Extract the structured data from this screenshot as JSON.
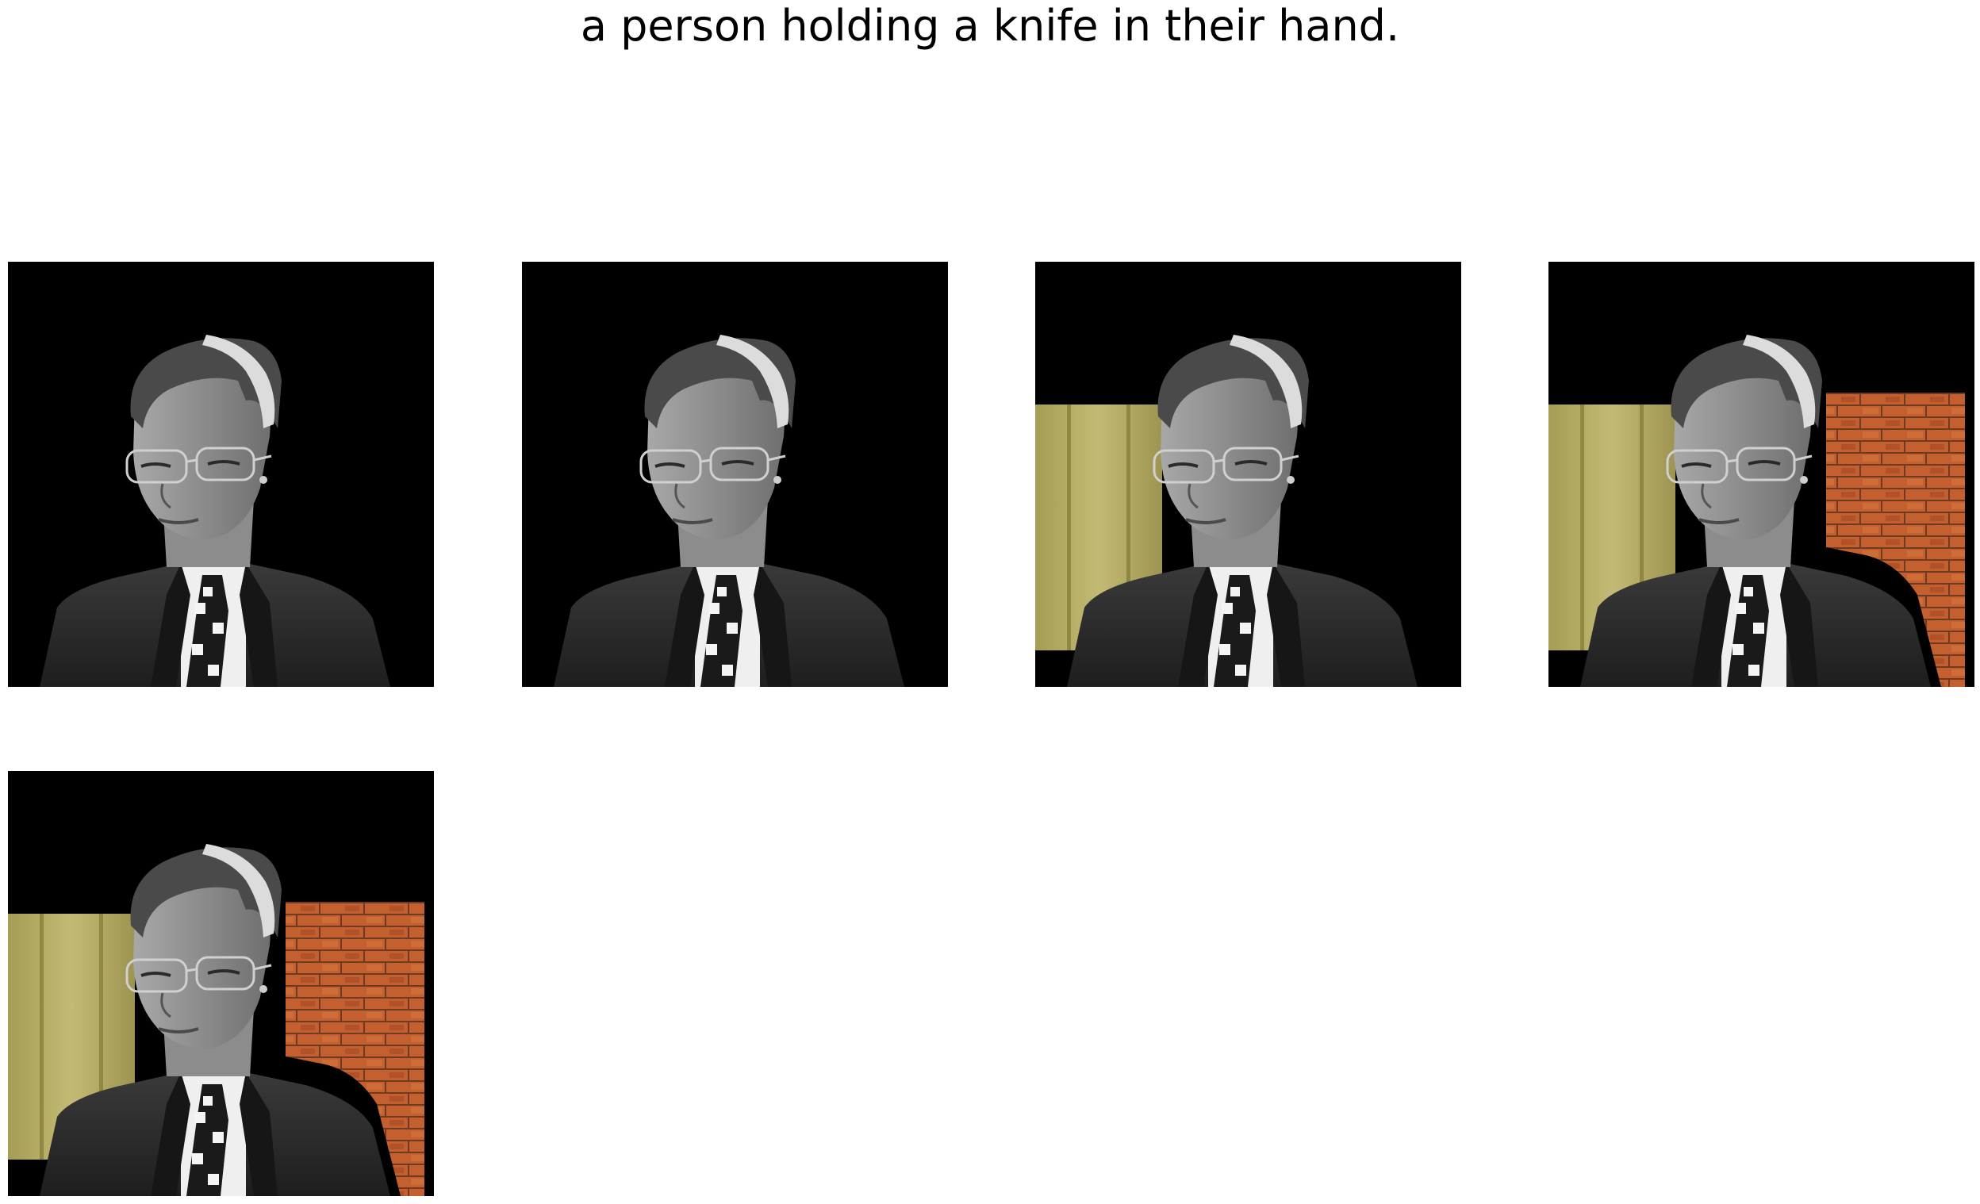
{
  "caption": "a person holding a knife in their hand.",
  "panels": [
    {
      "id": "panel-1",
      "background": "none"
    },
    {
      "id": "panel-2",
      "background": "none"
    },
    {
      "id": "panel-3",
      "background": "office-wall-left"
    },
    {
      "id": "panel-4",
      "background": "office-wall-left-and-brick-wall-right"
    },
    {
      "id": "panel-5",
      "background": "office-wall-left-and-brick-wall-right"
    }
  ],
  "colors": {
    "mask": "#000000",
    "suit": "#2e2e2e",
    "skin": "#8a8a8a",
    "hair": "#4a4a4a",
    "headband": "#d8d8d8",
    "shirt": "#eeeeee",
    "office_wall": "#b5ad64",
    "brick": "#b5542e"
  }
}
